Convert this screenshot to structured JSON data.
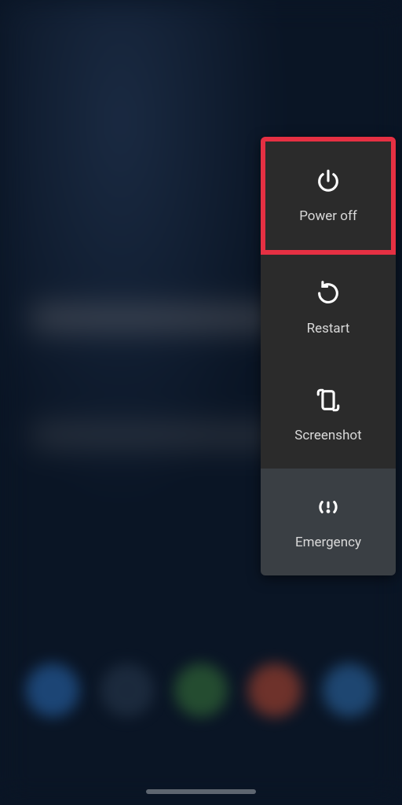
{
  "power_menu": {
    "items": [
      {
        "label": "Power off",
        "highlighted": true
      },
      {
        "label": "Restart",
        "highlighted": false
      },
      {
        "label": "Screenshot",
        "highlighted": false
      },
      {
        "label": "Emergency",
        "highlighted": false
      }
    ]
  },
  "colors": {
    "highlight_border": "#e53043",
    "menu_bg": "#2b2b2b",
    "emergency_bg": "#3a3f44"
  }
}
